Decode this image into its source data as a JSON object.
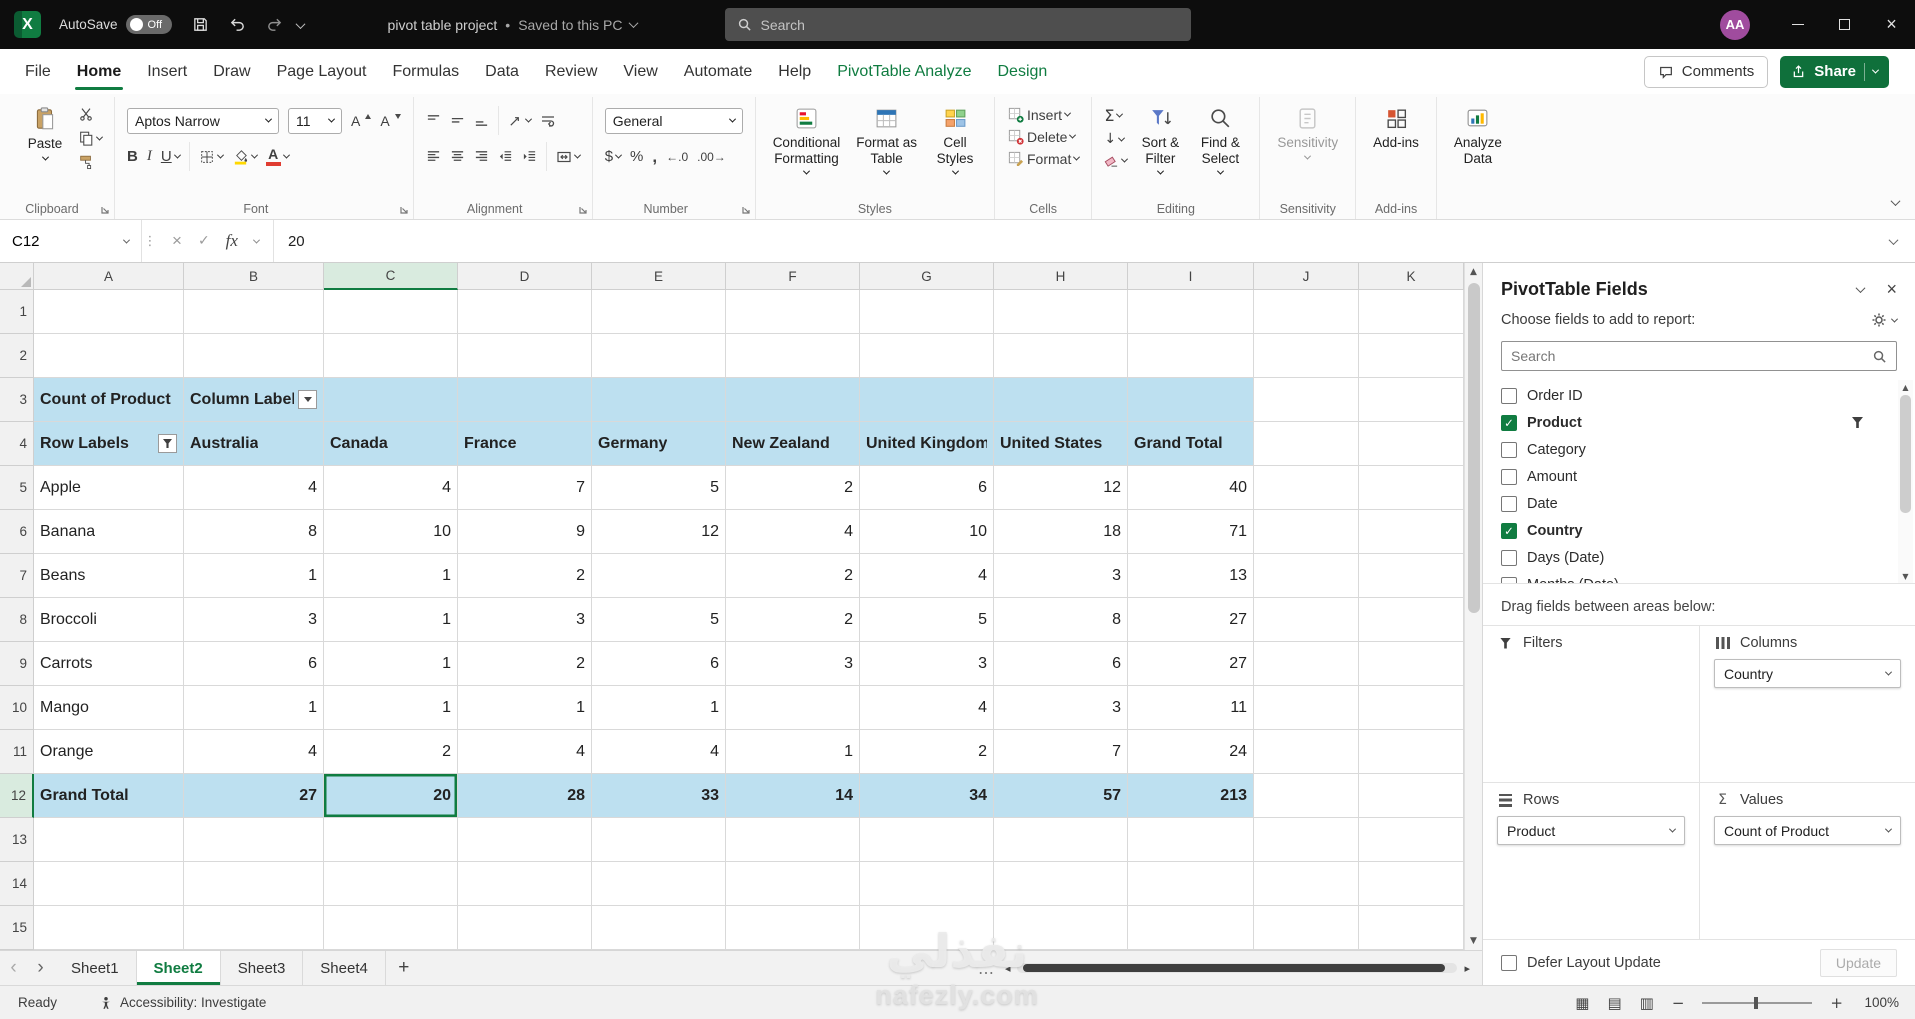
{
  "colors": {
    "accent_green": "#107C41",
    "share_green": "#0F703B",
    "titlebar_bg": "#0D0D0D",
    "pivot_fill": "#BDE0F0",
    "ribbon_bg": "#FBFBFB",
    "grid_line": "#D9D9D9",
    "header_bg": "#F1F1F1",
    "avatar_bg": "#A04C9E"
  },
  "glyphs": {
    "bold": "B",
    "italic": "I",
    "underline": "U",
    "font_grow": "A",
    "font_shrink": "A",
    "font_color_a": "A",
    "dollar": "$",
    "percent": "%",
    "comma": ",",
    "inc_decimal": "←.0",
    "dec_decimal": ".00→",
    "sigma": "Σ",
    "fill_down": "↓",
    "cancel": "×",
    "enter": "✓",
    "name_box_dots": "⋮",
    "minimize": "—",
    "close": "×",
    "tab_prev": "‹",
    "tab_next": "›",
    "tab_overflow": "…",
    "scroll_up": "▲",
    "scroll_down": "▼",
    "scroll_left": "◂",
    "scroll_right": "▸",
    "add_sheet": "+",
    "zoom_out": "−",
    "zoom_in": "+",
    "view_normal": "▦",
    "view_layout": "▤",
    "view_break": "▥"
  },
  "titlebar": {
    "autosave_label": "AutoSave",
    "autosave_state": "Off",
    "doc_title": "pivot table project",
    "doc_separator": "•",
    "doc_status": "Saved to this PC",
    "search_placeholder": "Search",
    "avatar_initials": "AA"
  },
  "menubar": {
    "tabs": [
      {
        "label": "File",
        "state": "normal"
      },
      {
        "label": "Home",
        "state": "active"
      },
      {
        "label": "Insert",
        "state": "normal"
      },
      {
        "label": "Draw",
        "state": "normal"
      },
      {
        "label": "Page Layout",
        "state": "normal"
      },
      {
        "label": "Formulas",
        "state": "normal"
      },
      {
        "label": "Data",
        "state": "normal"
      },
      {
        "label": "Review",
        "state": "normal"
      },
      {
        "label": "View",
        "state": "normal"
      },
      {
        "label": "Automate",
        "state": "normal"
      },
      {
        "label": "Help",
        "state": "normal"
      },
      {
        "label": "PivotTable Analyze",
        "state": "contextual"
      },
      {
        "label": "Design",
        "state": "contextual"
      }
    ],
    "comments_label": "Comments",
    "share_label": "Share"
  },
  "ribbon": {
    "clipboard": {
      "group_label": "Clipboard",
      "paste_label": "Paste"
    },
    "font": {
      "group_label": "Font",
      "font_name": "Aptos Narrow",
      "font_size": "11"
    },
    "alignment": {
      "group_label": "Alignment"
    },
    "number": {
      "group_label": "Number",
      "format_value": "General"
    },
    "styles": {
      "group_label": "Styles",
      "conditional_formatting": [
        "Conditional",
        "Formatting"
      ],
      "format_as_table": [
        "Format as",
        "Table"
      ],
      "cell_styles": [
        "Cell",
        "Styles"
      ]
    },
    "cells": {
      "group_label": "Cells",
      "insert_label": "Insert",
      "delete_label": "Delete",
      "format_label": "Format"
    },
    "editing": {
      "group_label": "Editing",
      "sort_filter": [
        "Sort &",
        "Filter"
      ],
      "find_select": [
        "Find &",
        "Select"
      ]
    },
    "sensitivity": {
      "group_label": "Sensitivity",
      "button_label": "Sensitivity"
    },
    "addins": {
      "group_label": "Add-ins",
      "button_label": "Add-ins"
    },
    "analyze": {
      "button_label": [
        "Analyze",
        "Data"
      ]
    }
  },
  "formula_bar": {
    "name_box": "C12",
    "fx_label": "fx",
    "value": "20"
  },
  "grid": {
    "column_headers": [
      "A",
      "B",
      "C",
      "D",
      "E",
      "F",
      "G",
      "H",
      "I",
      "J",
      "K"
    ],
    "row_headers": [
      "1",
      "2",
      "3",
      "4",
      "5",
      "6",
      "7",
      "8",
      "9",
      "10",
      "11",
      "12",
      "13",
      "14",
      "15"
    ],
    "active_cell": "C12",
    "pivot": {
      "count_label": "Count of Product",
      "column_labels": "Column Labels",
      "header_row": [
        "Row Labels",
        "Australia",
        "Canada",
        "France",
        "Germany",
        "New Zealand",
        "United Kingdom",
        "United States",
        "Grand Total"
      ],
      "data_rows": [
        [
          "Apple",
          "4",
          "4",
          "7",
          "5",
          "2",
          "6",
          "12",
          "40"
        ],
        [
          "Banana",
          "8",
          "10",
          "9",
          "12",
          "4",
          "10",
          "18",
          "71"
        ],
        [
          "Beans",
          "1",
          "1",
          "2",
          "",
          "2",
          "4",
          "3",
          "13"
        ],
        [
          "Broccoli",
          "3",
          "1",
          "3",
          "5",
          "2",
          "5",
          "8",
          "27"
        ],
        [
          "Carrots",
          "6",
          "1",
          "2",
          "6",
          "3",
          "3",
          "6",
          "27"
        ],
        [
          "Mango",
          "1",
          "1",
          "1",
          "1",
          "",
          "4",
          "3",
          "11"
        ],
        [
          "Orange",
          "4",
          "2",
          "4",
          "4",
          "1",
          "2",
          "7",
          "24"
        ]
      ],
      "grand_total_row": [
        "Grand Total",
        "27",
        "20",
        "28",
        "33",
        "14",
        "34",
        "57",
        "213"
      ]
    }
  },
  "sheet_tabs": {
    "tabs": [
      {
        "label": "Sheet1",
        "active": false
      },
      {
        "label": "Sheet2",
        "active": true
      },
      {
        "label": "Sheet3",
        "active": false
      },
      {
        "label": "Sheet4",
        "active": false
      }
    ]
  },
  "status_bar": {
    "mode": "Ready",
    "accessibility": "Accessibility: Investigate",
    "zoom": "100%"
  },
  "fields_pane": {
    "title": "PivotTable Fields",
    "subtitle": "Choose fields to add to report:",
    "search_placeholder": "Search",
    "fields": [
      {
        "name": "Order ID",
        "checked": false,
        "filtered": false
      },
      {
        "name": "Product",
        "checked": true,
        "filtered": true
      },
      {
        "name": "Category",
        "checked": false,
        "filtered": false
      },
      {
        "name": "Amount",
        "checked": false,
        "filtered": false
      },
      {
        "name": "Date",
        "checked": false,
        "filtered": false
      },
      {
        "name": "Country",
        "checked": true,
        "filtered": false
      },
      {
        "name": "Days (Date)",
        "checked": false,
        "filtered": false
      },
      {
        "name": "Months (Date)",
        "checked": false,
        "filtered": false
      }
    ],
    "drag_hint": "Drag fields between areas below:",
    "areas": [
      {
        "key": "filters",
        "label": "Filters",
        "icon": "funnel-icon",
        "items": []
      },
      {
        "key": "columns",
        "label": "Columns",
        "icon": "columns-icon",
        "items": [
          "Country"
        ]
      },
      {
        "key": "rows",
        "label": "Rows",
        "icon": "rows-icon",
        "items": [
          "Product"
        ]
      },
      {
        "key": "values",
        "label": "Values",
        "icon": "sigma-icon",
        "items": [
          "Count of Product"
        ]
      }
    ],
    "defer_label": "Defer Layout Update",
    "update_label": "Update"
  },
  "watermark": {
    "arabic": "نفذلي",
    "domain": "nafezly.com"
  }
}
